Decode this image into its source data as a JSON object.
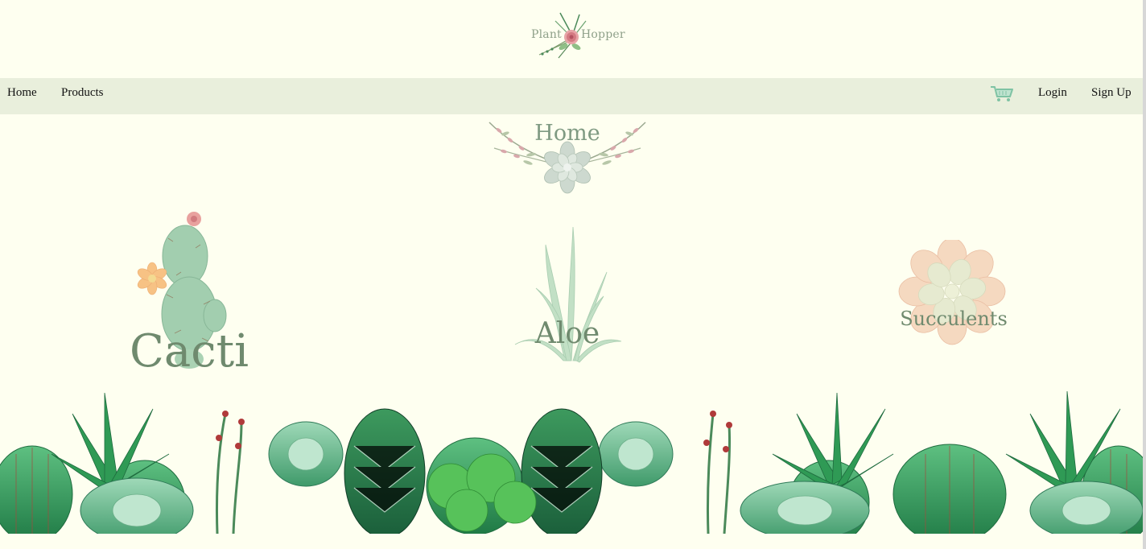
{
  "logo": {
    "word_left": "Plant",
    "word_right": "Hopper",
    "icon": "floral-succulent-logo-icon"
  },
  "nav": {
    "home": "Home",
    "products": "Products",
    "cart_icon": "shopping-cart-icon",
    "login": "Login",
    "signup": "Sign Up"
  },
  "page": {
    "heading": "Home"
  },
  "categories": [
    {
      "label": "Cacti",
      "icon": "prickly-pear-cactus-icon"
    },
    {
      "label": "Aloe",
      "icon": "aloe-plant-icon"
    },
    {
      "label": "Succulents",
      "icon": "echeveria-succulent-icon"
    }
  ],
  "colors": {
    "background": "#fefff0",
    "navbar": "#e9efdc",
    "label_green": "#6f8a6e",
    "leaf_green": "#3f9a5c",
    "flower_pink": "#e38a8a"
  }
}
